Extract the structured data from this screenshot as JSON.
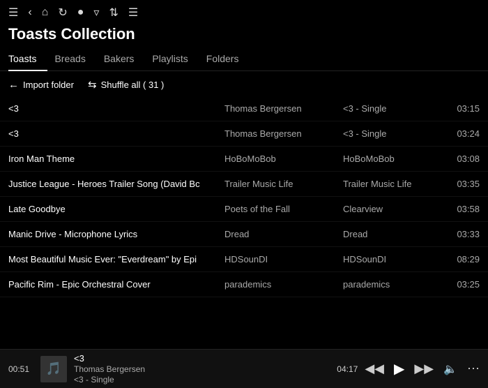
{
  "app": {
    "title": "Toasts Collection"
  },
  "nav": {
    "icons": [
      "hamburger",
      "back",
      "home",
      "refresh",
      "search",
      "filter",
      "sort",
      "list"
    ]
  },
  "tabs": [
    {
      "id": "toasts",
      "label": "Toasts",
      "active": true
    },
    {
      "id": "breads",
      "label": "Breads",
      "active": false
    },
    {
      "id": "bakers",
      "label": "Bakers",
      "active": false
    },
    {
      "id": "playlists",
      "label": "Playlists",
      "active": false
    },
    {
      "id": "folders",
      "label": "Folders",
      "active": false
    }
  ],
  "actions": {
    "import_label": "Import folder",
    "shuffle_label": "Shuffle all ( 31 )"
  },
  "tracks": [
    {
      "title": "<3",
      "artist": "Thomas Bergersen",
      "album": "<3 - Single",
      "duration": "03:15"
    },
    {
      "title": "<3",
      "artist": "Thomas Bergersen",
      "album": "<3 - Single",
      "duration": "03:24"
    },
    {
      "title": "Iron Man Theme",
      "artist": "HoBoMoBob",
      "album": "HoBoMoBob",
      "duration": "03:08"
    },
    {
      "title": "Justice League - Heroes Trailer Song (David Bc",
      "artist": "Trailer Music Life",
      "album": "Trailer Music Life",
      "duration": "03:35"
    },
    {
      "title": "Late Goodbye",
      "artist": "Poets of the Fall",
      "album": "Clearview",
      "duration": "03:58"
    },
    {
      "title": "Manic Drive - Microphone Lyrics",
      "artist": "Dread",
      "album": "Dread",
      "duration": "03:33"
    },
    {
      "title": "Most Beautiful Music Ever: \"Everdream\" by Epi",
      "artist": "HDSounDI",
      "album": "HDSounDI",
      "duration": "08:29"
    },
    {
      "title": "Pacific Rim - Epic Orchestral Cover",
      "artist": "parademics",
      "album": "parademics",
      "duration": "03:25"
    }
  ],
  "now_playing": {
    "current_time": "00:51",
    "total_time": "04:17",
    "track_name": "<3",
    "artist": "Thomas Bergersen",
    "album": "<3 - Single",
    "thumb_emoji": "🎵"
  }
}
